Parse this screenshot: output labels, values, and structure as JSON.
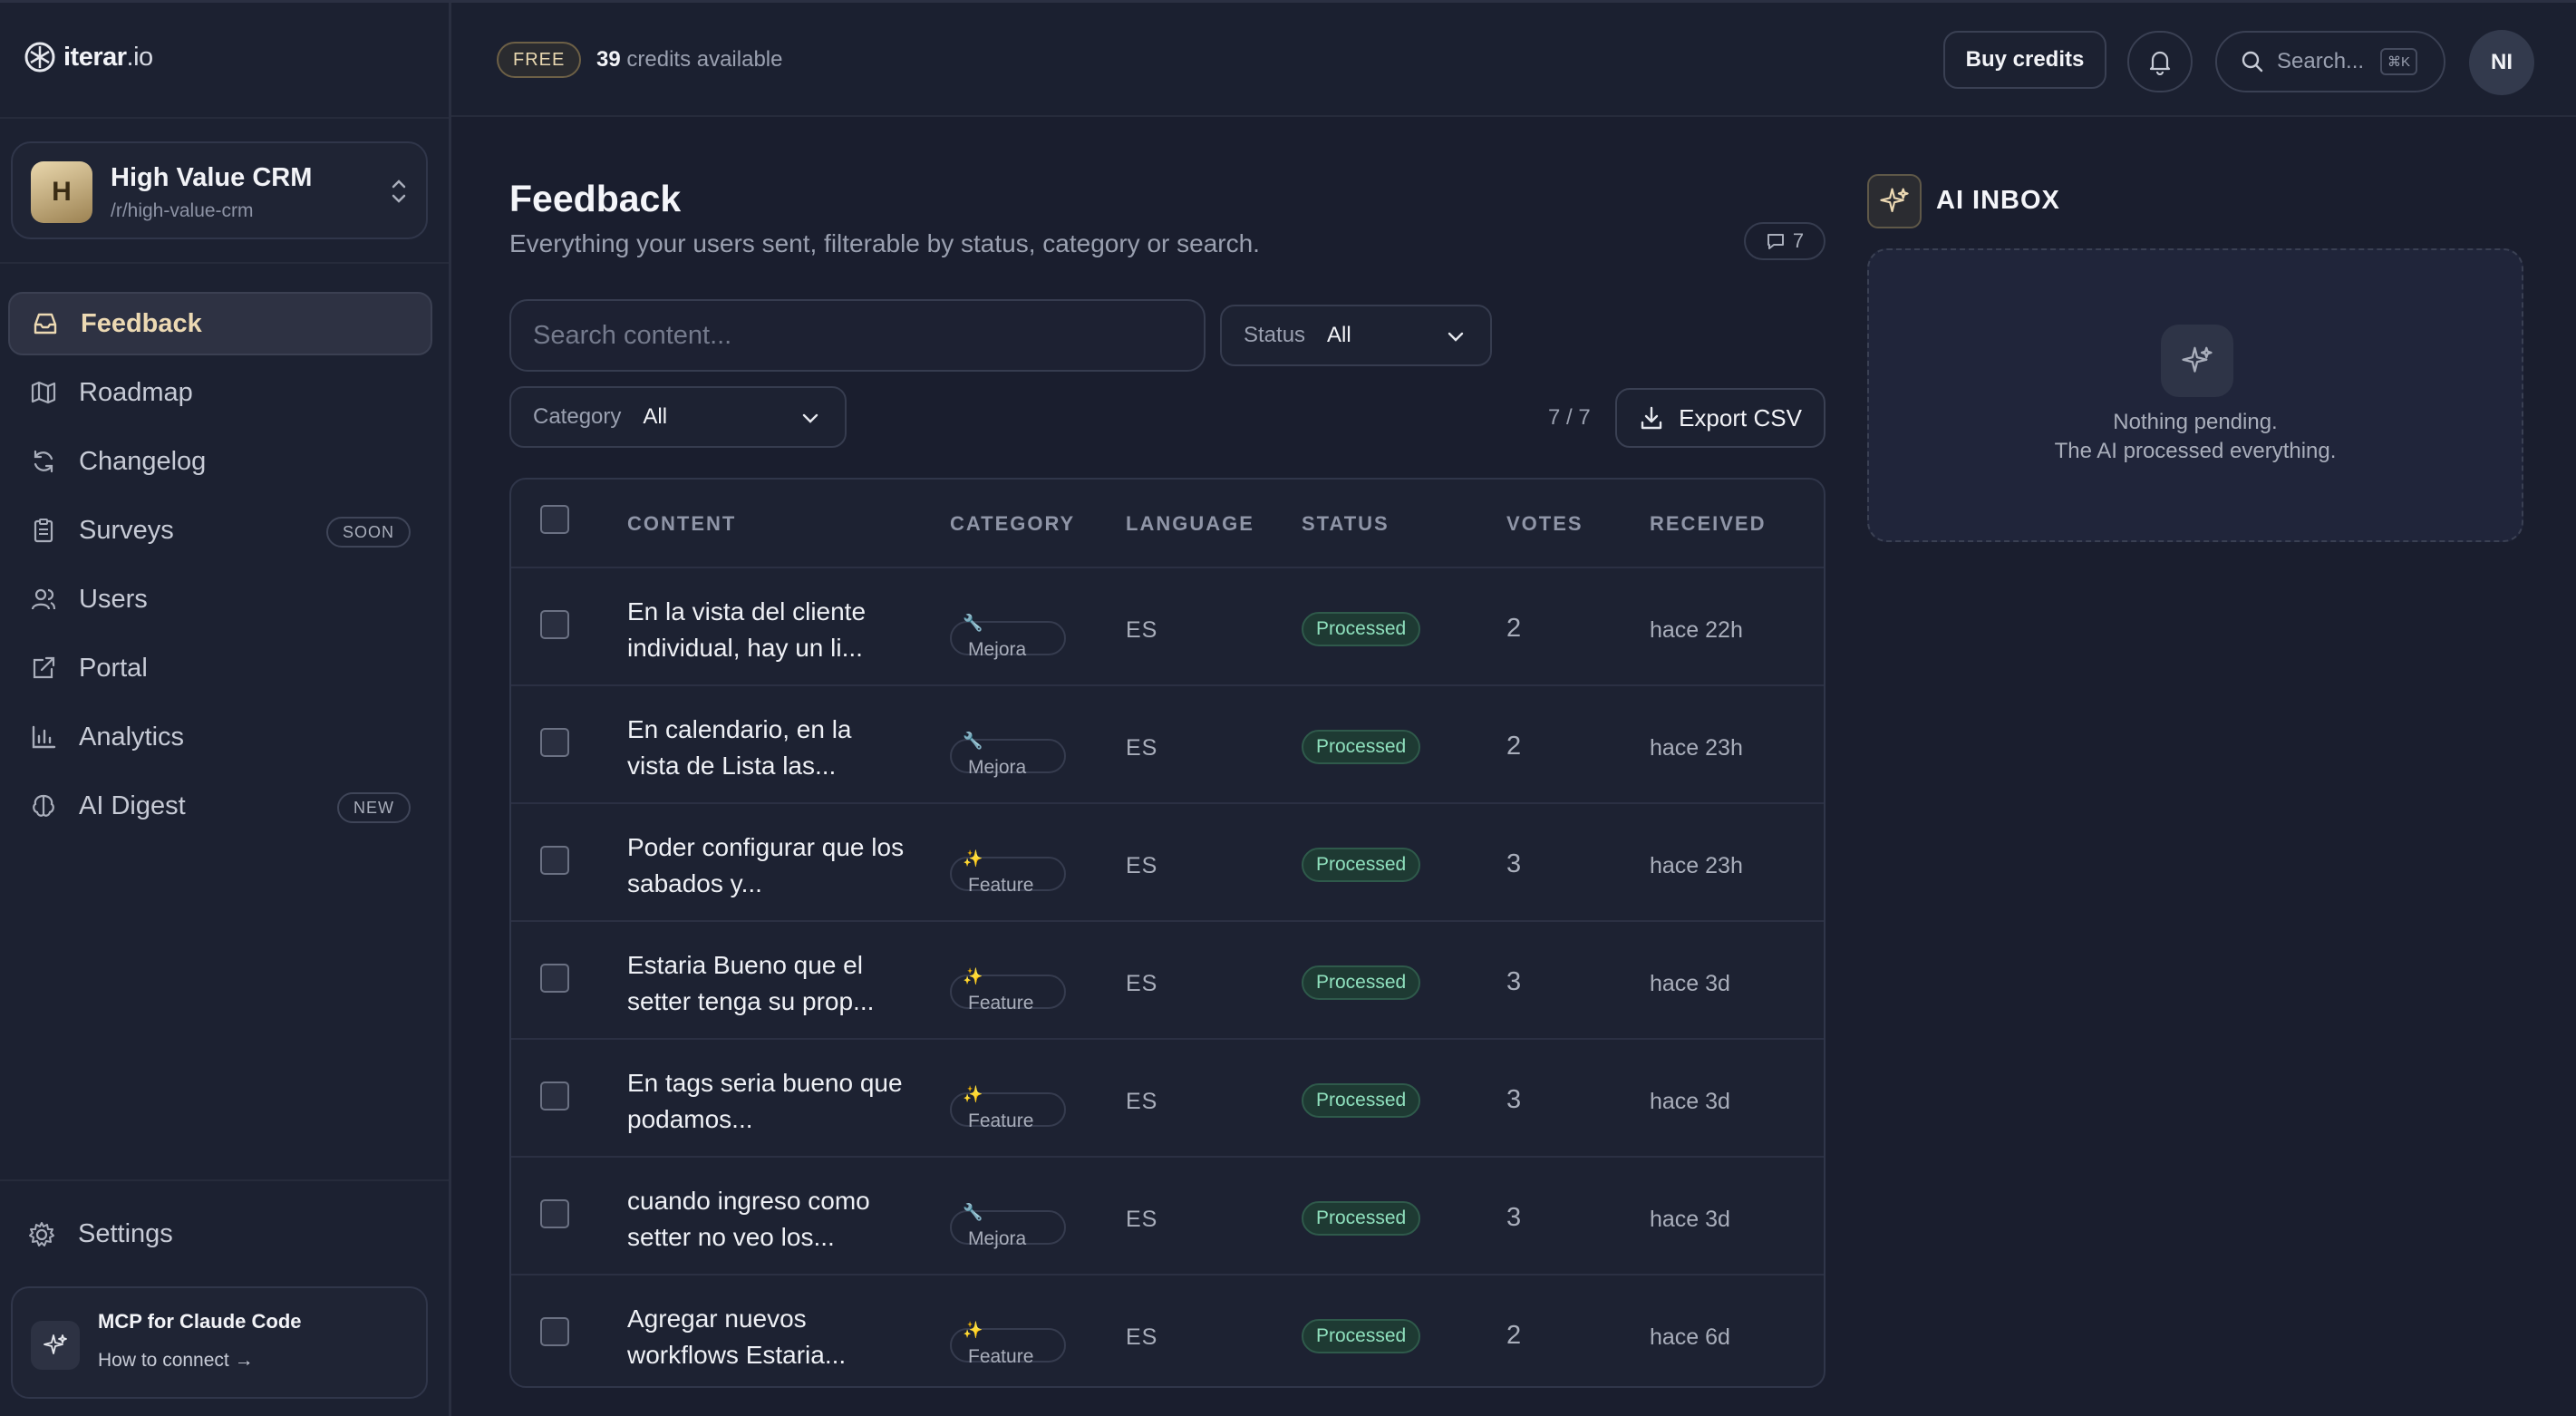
{
  "brand": {
    "name": "iterar",
    "tld": ".io"
  },
  "project": {
    "initial": "H",
    "name": "High Value CRM",
    "slug": "/r/high-value-crm"
  },
  "nav": [
    {
      "label": "Feedback",
      "icon": "inbox-icon",
      "active": true,
      "badge": ""
    },
    {
      "label": "Roadmap",
      "icon": "map-icon",
      "active": false,
      "badge": ""
    },
    {
      "label": "Changelog",
      "icon": "refresh-icon",
      "active": false,
      "badge": ""
    },
    {
      "label": "Surveys",
      "icon": "clipboard-icon",
      "active": false,
      "badge": "SOON"
    },
    {
      "label": "Users",
      "icon": "users-icon",
      "active": false,
      "badge": ""
    },
    {
      "label": "Portal",
      "icon": "external-link-icon",
      "active": false,
      "badge": ""
    },
    {
      "label": "Analytics",
      "icon": "bar-chart-icon",
      "active": false,
      "badge": ""
    },
    {
      "label": "AI Digest",
      "icon": "brain-icon",
      "active": false,
      "badge": "NEW"
    }
  ],
  "settings": {
    "label": "Settings"
  },
  "mcp": {
    "title": "MCP for Claude Code",
    "link": "How to connect →"
  },
  "header": {
    "plan": "FREE",
    "credits_count": "39",
    "credits_text": "credits available",
    "buy_label": "Buy credits",
    "search_label": "Search...",
    "search_kbd": "⌘K",
    "user_initials": "NI"
  },
  "page": {
    "title": "Feedback",
    "subtitle": "Everything your users sent, filterable by status, category or search.",
    "comment_count": "7",
    "search_placeholder": "Search content...",
    "status_label": "Status",
    "status_value": "All",
    "category_label": "Category",
    "category_value": "All",
    "count": "7 / 7",
    "export_label": "Export CSV"
  },
  "table": {
    "columns": [
      "CONTENT",
      "CATEGORY",
      "LANGUAGE",
      "STATUS",
      "VOTES",
      "RECEIVED"
    ],
    "rows": [
      {
        "content": "En la vista del cliente individual, hay un li...",
        "category": "Mejora",
        "category_icon": "🔧",
        "language": "ES",
        "status": "Processed",
        "votes": "2",
        "received": "hace 22h"
      },
      {
        "content": "En calendario, en la vista de Lista las...",
        "category": "Mejora",
        "category_icon": "🔧",
        "language": "ES",
        "status": "Processed",
        "votes": "2",
        "received": "hace 23h"
      },
      {
        "content": "Poder configurar que los sabados y...",
        "category": "Feature",
        "category_icon": "✨",
        "language": "ES",
        "status": "Processed",
        "votes": "3",
        "received": "hace 23h"
      },
      {
        "content": "Estaria Bueno que el setter tenga su prop...",
        "category": "Feature",
        "category_icon": "✨",
        "language": "ES",
        "status": "Processed",
        "votes": "3",
        "received": "hace 3d"
      },
      {
        "content": "En tags seria bueno que podamos...",
        "category": "Feature",
        "category_icon": "✨",
        "language": "ES",
        "status": "Processed",
        "votes": "3",
        "received": "hace 3d"
      },
      {
        "content": "cuando ingreso como setter no veo los...",
        "category": "Mejora",
        "category_icon": "🔧",
        "language": "ES",
        "status": "Processed",
        "votes": "3",
        "received": "hace 3d"
      },
      {
        "content": "Agregar nuevos workflows Estaria...",
        "category": "Feature",
        "category_icon": "✨",
        "language": "ES",
        "status": "Processed",
        "votes": "2",
        "received": "hace 6d"
      }
    ]
  },
  "ai_inbox": {
    "title": "AI INBOX",
    "empty_line1": "Nothing pending.",
    "empty_line2": "The AI processed everything."
  },
  "colors": {
    "accent": "#ecd9b3",
    "status_processed": "#8fe0bd",
    "background": "#1a1e2e"
  }
}
